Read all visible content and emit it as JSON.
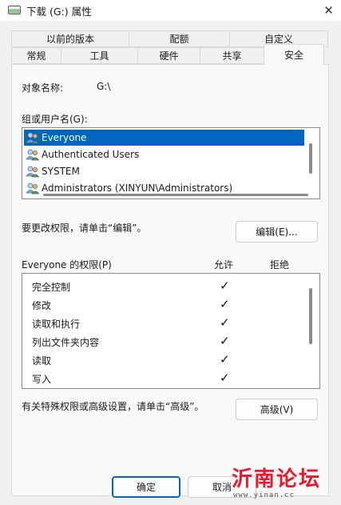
{
  "window": {
    "title": "下载 (G:) 属性",
    "close_glyph": "✕"
  },
  "tabs": {
    "row1": [
      "以前的版本",
      "配额",
      "自定义"
    ],
    "row2": [
      "常规",
      "工具",
      "硬件",
      "共享",
      "安全"
    ],
    "active": "安全"
  },
  "security": {
    "object_name_label": "对象名称:",
    "object_name_value": "G:\\",
    "group_label": "组或用户名(G):",
    "users": [
      {
        "name": "Everyone",
        "icon": "users-group-icon",
        "selected": true
      },
      {
        "name": "Authenticated Users",
        "icon": "users-group-icon",
        "selected": false
      },
      {
        "name": "SYSTEM",
        "icon": "users-group-icon",
        "selected": false
      },
      {
        "name": "Administrators (XINYUN\\Administrators)",
        "icon": "users-group-icon",
        "selected": false
      }
    ],
    "edit_hint": "要更改权限，请单击“编辑”。",
    "edit_button": "编辑(E)...",
    "permissions_label": "Everyone 的权限(P)",
    "allow_header": "允许",
    "deny_header": "拒绝",
    "permissions": [
      {
        "name": "完全控制",
        "allow": true,
        "deny": false
      },
      {
        "name": "修改",
        "allow": true,
        "deny": false
      },
      {
        "name": "读取和执行",
        "allow": true,
        "deny": false
      },
      {
        "name": "列出文件夹内容",
        "allow": true,
        "deny": false
      },
      {
        "name": "读取",
        "allow": true,
        "deny": false
      },
      {
        "name": "写入",
        "allow": true,
        "deny": false
      }
    ],
    "check_glyph": "✓",
    "advanced_hint": "有关特殊权限或高级设置，请单击“高级”。",
    "advanced_button": "高级(V)"
  },
  "footer": {
    "ok_button": "确定",
    "cancel_button": "取消"
  },
  "watermark": {
    "text": "沂南论坛",
    "url": "www.yinan.cc"
  },
  "colors": {
    "selection": "#0067c0",
    "accent": "#0067c0",
    "watermark": "#e8192c"
  }
}
